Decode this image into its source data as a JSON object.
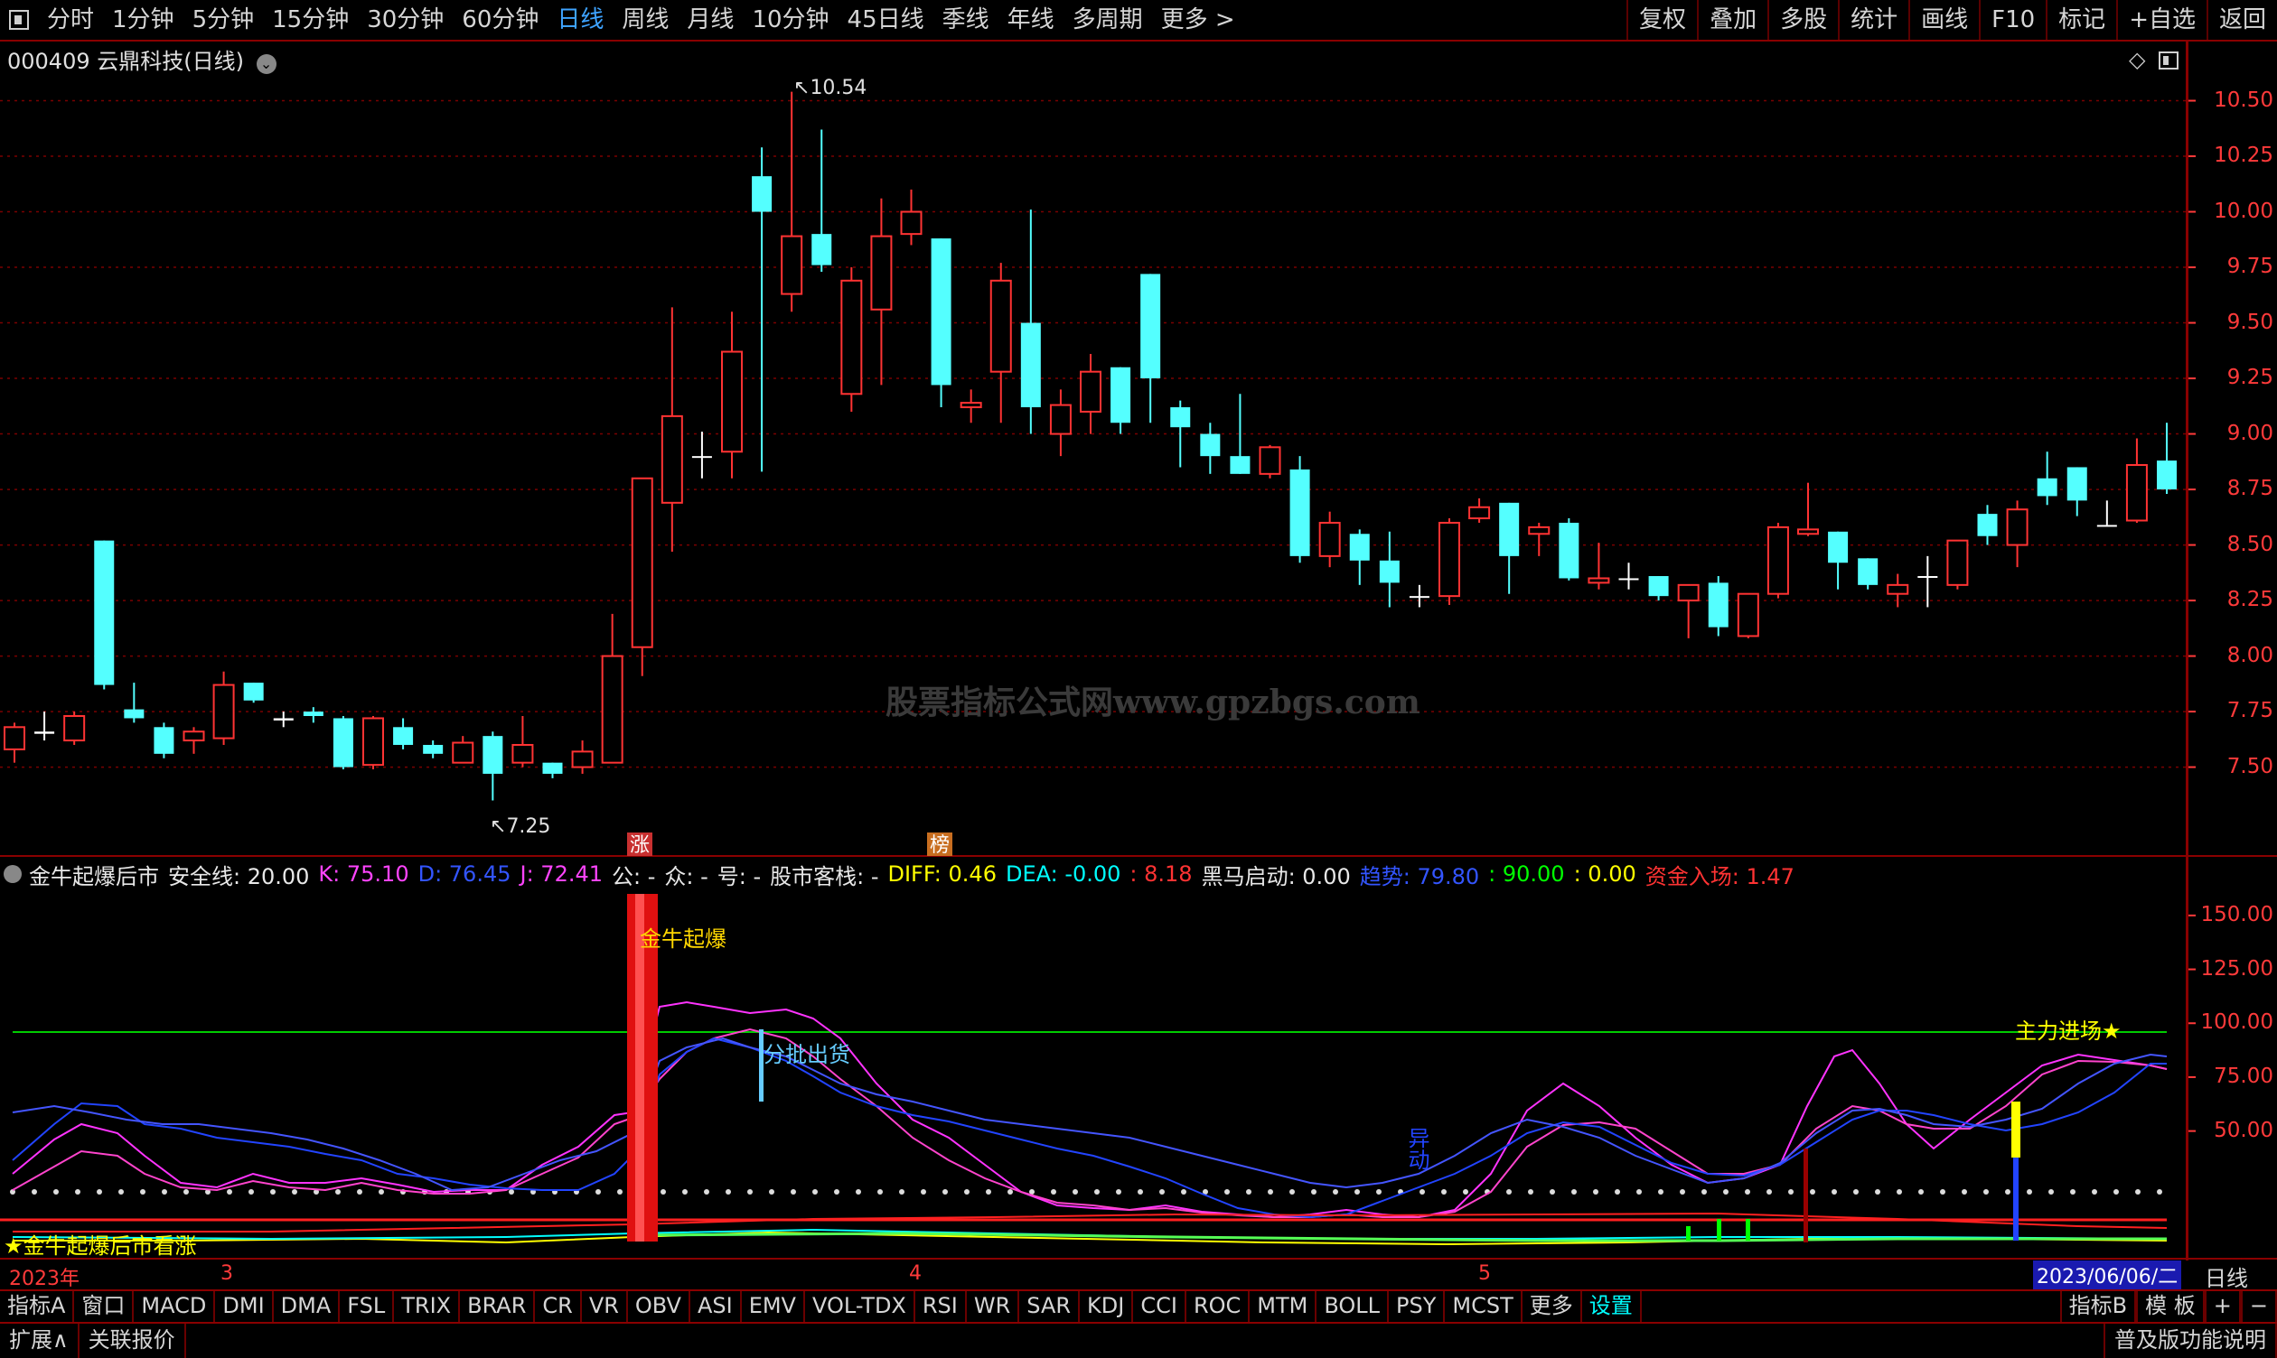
{
  "toolbar": {
    "periods": [
      "分时",
      "1分钟",
      "5分钟",
      "15分钟",
      "30分钟",
      "60分钟",
      "日线",
      "周线",
      "月线",
      "10分钟",
      "45日线",
      "季线",
      "年线",
      "多周期",
      "更多 >"
    ],
    "active_period": "日线",
    "right_tools": [
      "复权",
      "叠加",
      "多股",
      "统计",
      "画线",
      "F10",
      "标记",
      "+自选",
      "返回"
    ]
  },
  "stock": {
    "title": "000409 云鼎科技(日线)"
  },
  "price_axis": {
    "labels": [
      "10.50",
      "10.25",
      "10.00",
      "9.75",
      "9.50",
      "9.25",
      "9.00",
      "8.75",
      "8.50",
      "8.25",
      "8.00",
      "7.75",
      "7.50"
    ]
  },
  "annotations": {
    "high": "10.54",
    "low": "7.25",
    "badge_zhang": "涨",
    "badge_bang": "榜",
    "watermark": "股票指标公式网www.gpzbgs.com"
  },
  "indicator": {
    "header": [
      {
        "text": "金牛起爆后市",
        "color": "#e8e8e8"
      },
      {
        "text": "安全线: 20.00",
        "color": "#e8e8e8"
      },
      {
        "text": "K: 75.10",
        "color": "#ff44ff"
      },
      {
        "text": "D: 76.45",
        "color": "#3355ff"
      },
      {
        "text": "J: 72.41",
        "color": "#ff44ff"
      },
      {
        "text": "公: -",
        "color": "#e8e8e8"
      },
      {
        "text": "众: -",
        "color": "#e8e8e8"
      },
      {
        "text": "号: -",
        "color": "#e8e8e8"
      },
      {
        "text": "股市客栈: -",
        "color": "#e8e8e8"
      },
      {
        "text": "DIFF: 0.46",
        "color": "#ffff00"
      },
      {
        "text": "DEA: -0.00",
        "color": "#00ffff"
      },
      {
        "text": ": 8.18",
        "color": "#ff3333"
      },
      {
        "text": "黑马启动: 0.00",
        "color": "#e8e8e8"
      },
      {
        "text": "趋势: 79.80",
        "color": "#3355ff"
      },
      {
        "text": ": 90.00",
        "color": "#00ff00"
      },
      {
        "text": ": 0.00",
        "color": "#ffff00"
      },
      {
        "text": "资金入场: 1.47",
        "color": "#ff3333"
      }
    ],
    "axis_labels": [
      "150.00",
      "125.00",
      "100.00",
      "75.00",
      "50.00"
    ],
    "labels": {
      "jinniu": "金牛起爆",
      "fenpi": "分批出货",
      "yidong": "异动",
      "zhuli": "主力进场★",
      "footer": "★金牛起爆后市看涨"
    }
  },
  "date_axis": {
    "year": "2023年",
    "m3": "3",
    "m4": "4",
    "m5": "5",
    "current": "2023/06/06/二",
    "period": "日线"
  },
  "tabs": [
    "指标A",
    "窗口",
    "MACD",
    "DMI",
    "DMA",
    "FSL",
    "TRIX",
    "BRAR",
    "CR",
    "VR",
    "OBV",
    "ASI",
    "EMV",
    "VOL-TDX",
    "RSI",
    "WR",
    "SAR",
    "KDJ",
    "CCI",
    "ROC",
    "MTM",
    "BOLL",
    "PSY",
    "MCST",
    "更多",
    "设置"
  ],
  "tabs_right": [
    "指标B",
    "模 板",
    "+",
    "−"
  ],
  "status": {
    "left1": "扩展∧",
    "left2": "关联报价",
    "right": "普及版功能说明"
  },
  "colors": {
    "up": "#ff3333",
    "down": "#54ffff",
    "grid": "#8a0000"
  },
  "chart_data": {
    "type": "candlestick",
    "ylim": [
      7.1,
      10.62
    ],
    "candles": [
      [
        7.58,
        7.68,
        7.7,
        7.52
      ],
      [
        7.65,
        7.66,
        7.75,
        7.62
      ],
      [
        7.62,
        7.73,
        7.75,
        7.6
      ],
      [
        8.52,
        7.87,
        8.52,
        7.85
      ],
      [
        7.76,
        7.72,
        7.88,
        7.7
      ],
      [
        7.68,
        7.56,
        7.7,
        7.54
      ],
      [
        7.62,
        7.66,
        7.68,
        7.56
      ],
      [
        7.63,
        7.87,
        7.93,
        7.6
      ],
      [
        7.88,
        7.8,
        7.88,
        7.79
      ],
      [
        7.72,
        7.71,
        7.75,
        7.68
      ],
      [
        7.75,
        7.73,
        7.77,
        7.7
      ],
      [
        7.72,
        7.5,
        7.73,
        7.49
      ],
      [
        7.51,
        7.72,
        7.73,
        7.49
      ],
      [
        7.68,
        7.6,
        7.72,
        7.58
      ],
      [
        7.6,
        7.56,
        7.62,
        7.54
      ],
      [
        7.52,
        7.61,
        7.64,
        7.52
      ],
      [
        7.64,
        7.47,
        7.66,
        7.35
      ],
      [
        7.52,
        7.6,
        7.73,
        7.5
      ],
      [
        7.52,
        7.47,
        7.52,
        7.45
      ],
      [
        7.5,
        7.57,
        7.62,
        7.47
      ],
      [
        7.52,
        8.0,
        8.19,
        7.52
      ],
      [
        8.04,
        8.8,
        8.8,
        7.91
      ],
      [
        8.69,
        9.08,
        9.57,
        8.47
      ],
      [
        8.9,
        8.9,
        9.01,
        8.8
      ],
      [
        8.92,
        9.37,
        9.55,
        8.8
      ],
      [
        10.16,
        10.0,
        10.29,
        8.83
      ],
      [
        9.63,
        9.89,
        10.54,
        9.55
      ],
      [
        9.9,
        9.76,
        10.37,
        9.73
      ],
      [
        9.18,
        9.69,
        9.75,
        9.1
      ],
      [
        9.56,
        9.89,
        10.06,
        9.22
      ],
      [
        9.9,
        10.0,
        10.1,
        9.85
      ],
      [
        9.88,
        9.22,
        9.88,
        9.12
      ],
      [
        9.12,
        9.14,
        9.2,
        9.05
      ],
      [
        9.28,
        9.69,
        9.77,
        9.05
      ],
      [
        9.5,
        9.12,
        10.01,
        9.0
      ],
      [
        9.0,
        9.13,
        9.2,
        8.9
      ],
      [
        9.1,
        9.28,
        9.36,
        9.0
      ],
      [
        9.3,
        9.05,
        9.3,
        9.0
      ],
      [
        9.72,
        9.25,
        9.72,
        9.05
      ],
      [
        9.12,
        9.03,
        9.15,
        8.85
      ],
      [
        9.0,
        8.9,
        9.05,
        8.82
      ],
      [
        8.9,
        8.82,
        9.18,
        8.82
      ],
      [
        8.82,
        8.94,
        8.95,
        8.8
      ],
      [
        8.84,
        8.45,
        8.9,
        8.42
      ],
      [
        8.45,
        8.6,
        8.65,
        8.4
      ],
      [
        8.55,
        8.43,
        8.57,
        8.32
      ],
      [
        8.43,
        8.33,
        8.56,
        8.22
      ],
      [
        8.27,
        8.27,
        8.32,
        8.22
      ],
      [
        8.27,
        8.6,
        8.62,
        8.23
      ],
      [
        8.62,
        8.67,
        8.71,
        8.6
      ],
      [
        8.69,
        8.45,
        8.69,
        8.28
      ],
      [
        8.55,
        8.58,
        8.6,
        8.45
      ],
      [
        8.6,
        8.35,
        8.62,
        8.34
      ],
      [
        8.33,
        8.35,
        8.51,
        8.3
      ],
      [
        8.35,
        8.35,
        8.42,
        8.3
      ],
      [
        8.36,
        8.27,
        8.36,
        8.25
      ],
      [
        8.25,
        8.32,
        8.32,
        8.08
      ],
      [
        8.33,
        8.13,
        8.36,
        8.09
      ],
      [
        8.09,
        8.28,
        8.28,
        8.08
      ],
      [
        8.28,
        8.58,
        8.6,
        8.26
      ],
      [
        8.55,
        8.57,
        8.78,
        8.54
      ],
      [
        8.56,
        8.42,
        8.56,
        8.3
      ],
      [
        8.44,
        8.32,
        8.44,
        8.3
      ],
      [
        8.28,
        8.32,
        8.37,
        8.22
      ],
      [
        8.36,
        8.36,
        8.45,
        8.22
      ],
      [
        8.32,
        8.52,
        8.52,
        8.3
      ],
      [
        8.64,
        8.54,
        8.68,
        8.5
      ],
      [
        8.5,
        8.66,
        8.7,
        8.4
      ],
      [
        8.8,
        8.72,
        8.92,
        8.68
      ],
      [
        8.85,
        8.7,
        8.85,
        8.63
      ],
      [
        8.59,
        8.59,
        8.7,
        8.59
      ],
      [
        8.61,
        8.86,
        8.98,
        8.6
      ],
      [
        8.88,
        8.75,
        9.05,
        8.73
      ]
    ]
  }
}
